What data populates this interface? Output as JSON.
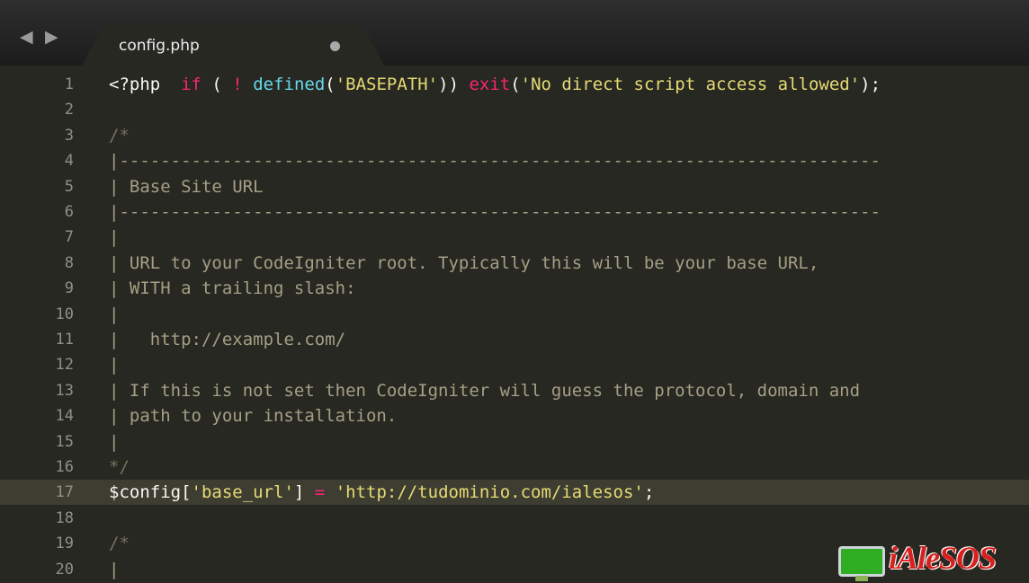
{
  "tab": {
    "title": "config.php",
    "nav_back": "◀",
    "nav_forward": "▶"
  },
  "lines": [
    {
      "num": "1",
      "tokens": [
        {
          "t": "<?php  ",
          "c": "p"
        },
        {
          "t": "if",
          "c": "k"
        },
        {
          "t": " ( ",
          "c": "p"
        },
        {
          "t": "!",
          "c": "k"
        },
        {
          "t": " ",
          "c": "p"
        },
        {
          "t": "defined",
          "c": "f"
        },
        {
          "t": "(",
          "c": "p"
        },
        {
          "t": "'BASEPATH'",
          "c": "s"
        },
        {
          "t": ")) ",
          "c": "p"
        },
        {
          "t": "exit",
          "c": "k"
        },
        {
          "t": "(",
          "c": "p"
        },
        {
          "t": "'No direct script access allowed'",
          "c": "s"
        },
        {
          "t": ");",
          "c": "p"
        }
      ]
    },
    {
      "num": "2",
      "tokens": []
    },
    {
      "num": "3",
      "tokens": [
        {
          "t": "/*",
          "c": "c"
        }
      ]
    },
    {
      "num": "4",
      "tokens": [
        {
          "t": "|--------------------------------------------------------------------------",
          "c": "cb"
        }
      ]
    },
    {
      "num": "5",
      "tokens": [
        {
          "t": "| Base Site URL",
          "c": "cb"
        }
      ]
    },
    {
      "num": "6",
      "tokens": [
        {
          "t": "|--------------------------------------------------------------------------",
          "c": "cb"
        }
      ]
    },
    {
      "num": "7",
      "tokens": [
        {
          "t": "|",
          "c": "cb"
        }
      ]
    },
    {
      "num": "8",
      "tokens": [
        {
          "t": "| URL to your CodeIgniter root. Typically this will be your base URL,",
          "c": "cb"
        }
      ]
    },
    {
      "num": "9",
      "tokens": [
        {
          "t": "| WITH a trailing slash:",
          "c": "cb"
        }
      ]
    },
    {
      "num": "10",
      "tokens": [
        {
          "t": "|",
          "c": "cb"
        }
      ]
    },
    {
      "num": "11",
      "tokens": [
        {
          "t": "|   http://example.com/",
          "c": "cb"
        }
      ]
    },
    {
      "num": "12",
      "tokens": [
        {
          "t": "|",
          "c": "cb"
        }
      ]
    },
    {
      "num": "13",
      "tokens": [
        {
          "t": "| If this is not set then CodeIgniter will guess the protocol, domain and",
          "c": "cb"
        }
      ]
    },
    {
      "num": "14",
      "tokens": [
        {
          "t": "| path to your installation.",
          "c": "cb"
        }
      ]
    },
    {
      "num": "15",
      "tokens": [
        {
          "t": "|",
          "c": "cb"
        }
      ]
    },
    {
      "num": "16",
      "tokens": [
        {
          "t": "*/",
          "c": "c"
        }
      ]
    },
    {
      "num": "17",
      "highlight": true,
      "tokens": [
        {
          "t": "$config[",
          "c": "p"
        },
        {
          "t": "'base_url'",
          "c": "s"
        },
        {
          "t": "] ",
          "c": "p"
        },
        {
          "t": "=",
          "c": "k"
        },
        {
          "t": " ",
          "c": "p"
        },
        {
          "t": "'http://tudominio.com/ialesos'",
          "c": "s"
        },
        {
          "t": ";",
          "c": "p"
        }
      ]
    },
    {
      "num": "18",
      "tokens": []
    },
    {
      "num": "19",
      "tokens": [
        {
          "t": "/*",
          "c": "c"
        }
      ]
    },
    {
      "num": "20",
      "tokens": [
        {
          "t": "|",
          "c": "cb"
        }
      ]
    }
  ],
  "watermark": {
    "text": "iAleSOS",
    "icon": "monitor-icon"
  },
  "colors": {
    "background": "#272822",
    "keyword": "#f92672",
    "function": "#66d9ef",
    "string": "#e6db74",
    "comment": "#75715e",
    "gutter": "#8f908a",
    "current_line": "#3e3d32"
  }
}
